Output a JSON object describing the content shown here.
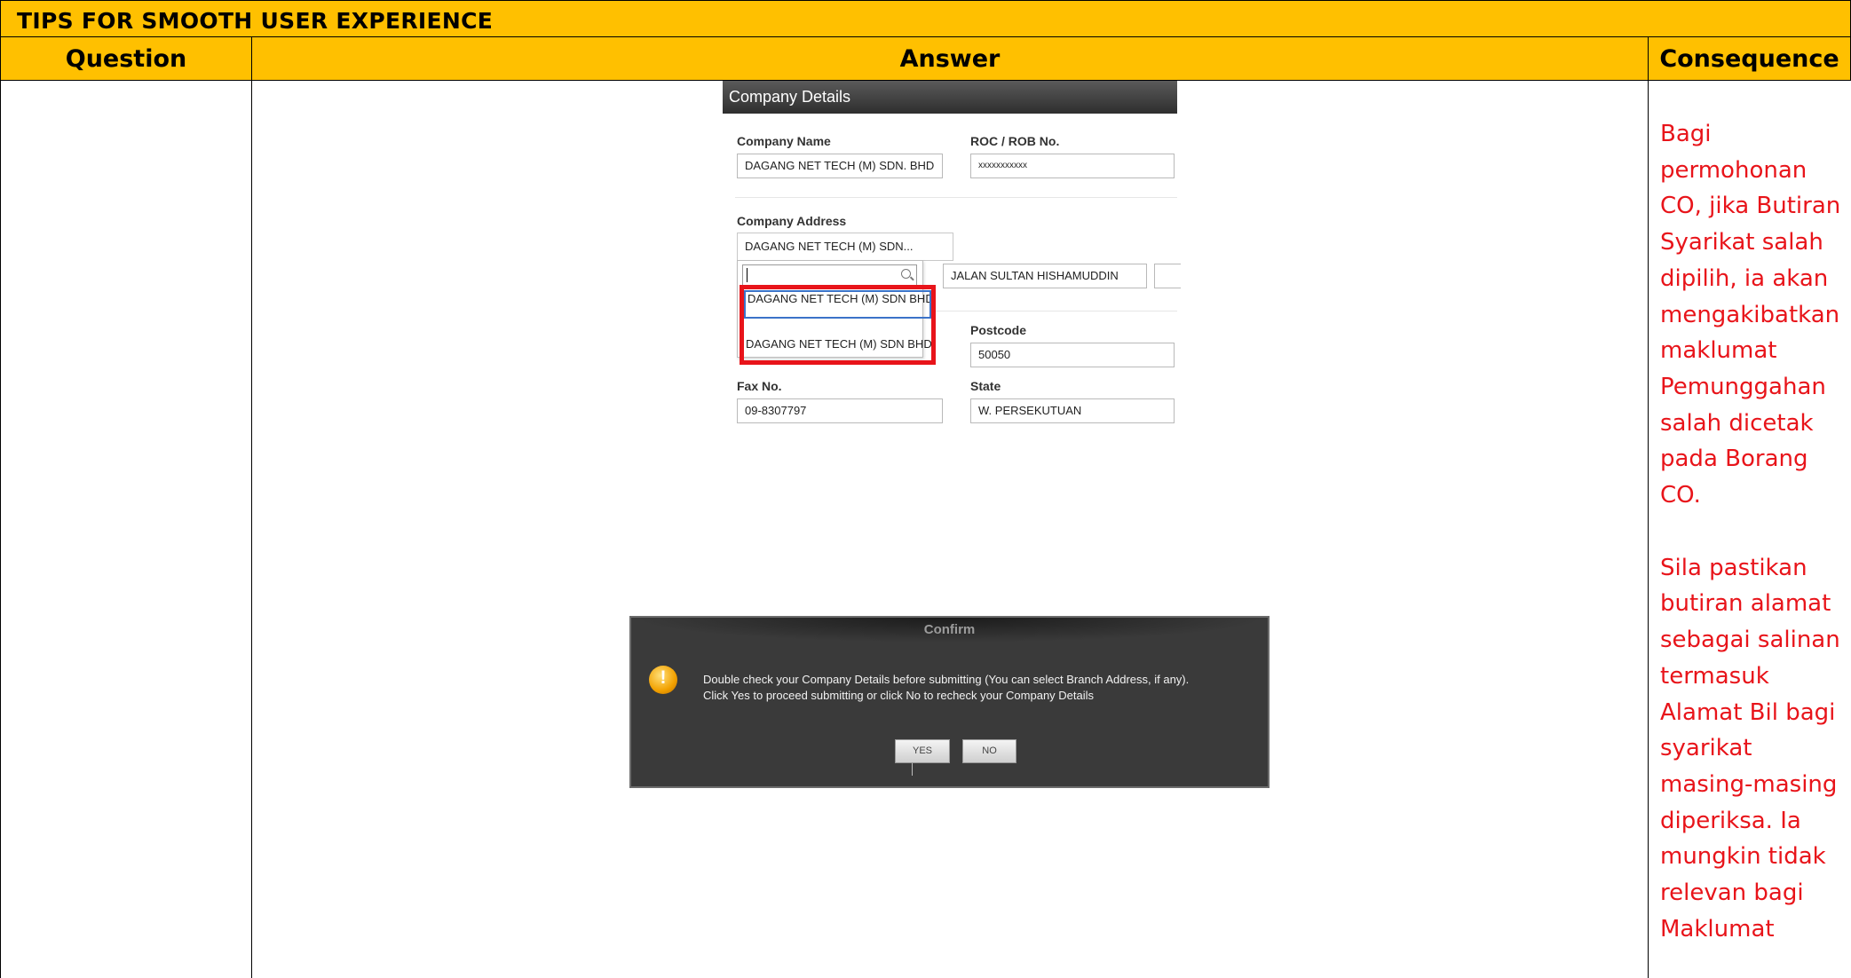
{
  "title": "TIPS FOR SMOOTH USER EXPERIENCE",
  "headers": {
    "question": "Question",
    "answer": "Answer",
    "consequence": "Consequence"
  },
  "colors": {
    "header_bg": "#ffc000",
    "consequence_text": "#e8141a",
    "highlight_box": "#e8141a"
  },
  "consequence": {
    "paragraph1": "Bagi permohonan CO, jika Butiran Syarikat salah dipilih, ia akan mengakibatkan maklumat Pemunggahan salah dicetak pada Borang CO.",
    "paragraph2": "Sila pastikan butiran alamat sebagai salinan termasuk Alamat Bil bagi syarikat masing-masing diperiksa. Ia mungkin tidak relevan bagi Maklumat"
  },
  "form": {
    "header": "Company Details",
    "company_name_label": "Company Name",
    "company_name_value": "DAGANG NET TECH     (M) SDN. BHD",
    "roc_label": "ROC / ROB No.",
    "roc_value": "xxxxxxxxxxx",
    "address_label": "Company Address",
    "address_selected": "DAGANG NET TECH     (M) SDN...",
    "street_value": "JALAN SULTAN HISHAMUDDIN",
    "postcode_label": "Postcode",
    "postcode_value": "50050",
    "fax_label": "Fax No.",
    "fax_value": "09-8307797",
    "state_label": "State",
    "state_value": "W. PERSEKUTUAN",
    "options": [
      "DAGANG NET TECH (M) SDN BHD",
      "DAGANG NET TECH (M) SDN BHD"
    ]
  },
  "dialog": {
    "title": "Confirm",
    "line1": "Double check your Company Details before submitting (You can select Branch Address, if any).",
    "line2": "Click Yes to proceed submitting or click No to recheck your Company Details",
    "yes": "YES",
    "no": "NO",
    "icon": "warning-icon"
  }
}
